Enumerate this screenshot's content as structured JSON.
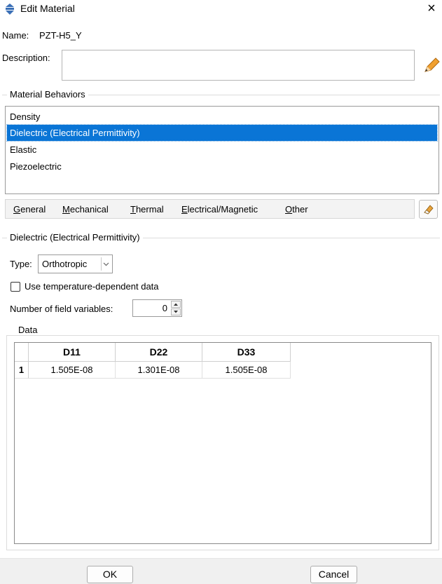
{
  "window": {
    "title": "Edit Material",
    "close_glyph": "×",
    "icon": "abaqus-app-icon"
  },
  "name_label": "Name:",
  "name_value": "PZT-H5_Y",
  "description_label": "Description:",
  "description_value": "",
  "behaviors": {
    "title": "Material Behaviors",
    "items": [
      {
        "label": "Density",
        "selected": false
      },
      {
        "label": "Dielectric (Electrical Permittivity)",
        "selected": true
      },
      {
        "label": "Elastic",
        "selected": false
      },
      {
        "label": "Piezoelectric",
        "selected": false
      }
    ]
  },
  "menus": [
    {
      "mnemonic": "G",
      "rest": "eneral"
    },
    {
      "mnemonic": "M",
      "rest": "echanical"
    },
    {
      "mnemonic": "T",
      "rest": "hermal"
    },
    {
      "mnemonic": "E",
      "rest": "lectrical/Magnetic"
    },
    {
      "mnemonic": "O",
      "rest": "ther"
    }
  ],
  "dielectric": {
    "title": "Dielectric (Electrical Permittivity)",
    "type_label": "Type:",
    "type_value": "Orthotropic",
    "temp_dependent_label": "Use temperature-dependent data",
    "temp_dependent_checked": false,
    "field_vars_label": "Number of field variables:",
    "field_vars_value": "0"
  },
  "data": {
    "title": "Data",
    "columns": [
      "D11",
      "D22",
      "D33"
    ],
    "rows": [
      {
        "index": "1",
        "cells": [
          "1.505E-08",
          "1.301E-08",
          "1.505E-08"
        ]
      }
    ]
  },
  "buttons": {
    "ok": "OK",
    "cancel": "Cancel"
  },
  "colors": {
    "selection": "#0a75d6",
    "pencil": "#f0a030"
  }
}
